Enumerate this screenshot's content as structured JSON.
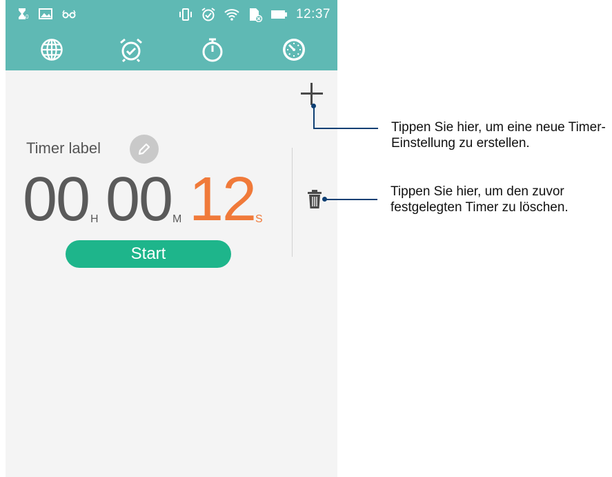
{
  "status_bar": {
    "time": "12:37",
    "left_icons": [
      "hourglass-icon",
      "image-icon",
      "glasses-icon"
    ],
    "right_icons": [
      "vibrate-icon",
      "alarm-icon",
      "wifi-icon",
      "sd-card-icon",
      "battery-icon"
    ]
  },
  "tabs": [
    {
      "icon": "globe-icon"
    },
    {
      "icon": "alarm-clock-icon"
    },
    {
      "icon": "stopwatch-icon"
    },
    {
      "icon": "timer-icon",
      "active": true
    }
  ],
  "timer": {
    "label": "Timer label",
    "hours": "00",
    "minutes": "00",
    "seconds": "12",
    "unit_h": "H",
    "unit_m": "M",
    "unit_s": "S",
    "start_label": "Start"
  },
  "callouts": {
    "add": "Tippen Sie hier, um eine neue Timer-Einstellung zu erstellen.",
    "add_line1": "Tippen Sie hier, um eine neue Timer-",
    "add_line2": "Einstellung zu erstellen.",
    "delete_line1": "Tippen Sie hier, um den zuvor",
    "delete_line2": "festgelegten Timer zu löschen."
  },
  "colors": {
    "header": "#5fb9b4",
    "accent_seconds": "#f07a3a",
    "start_button": "#1eb58b",
    "callout_line": "#0e3f73"
  }
}
